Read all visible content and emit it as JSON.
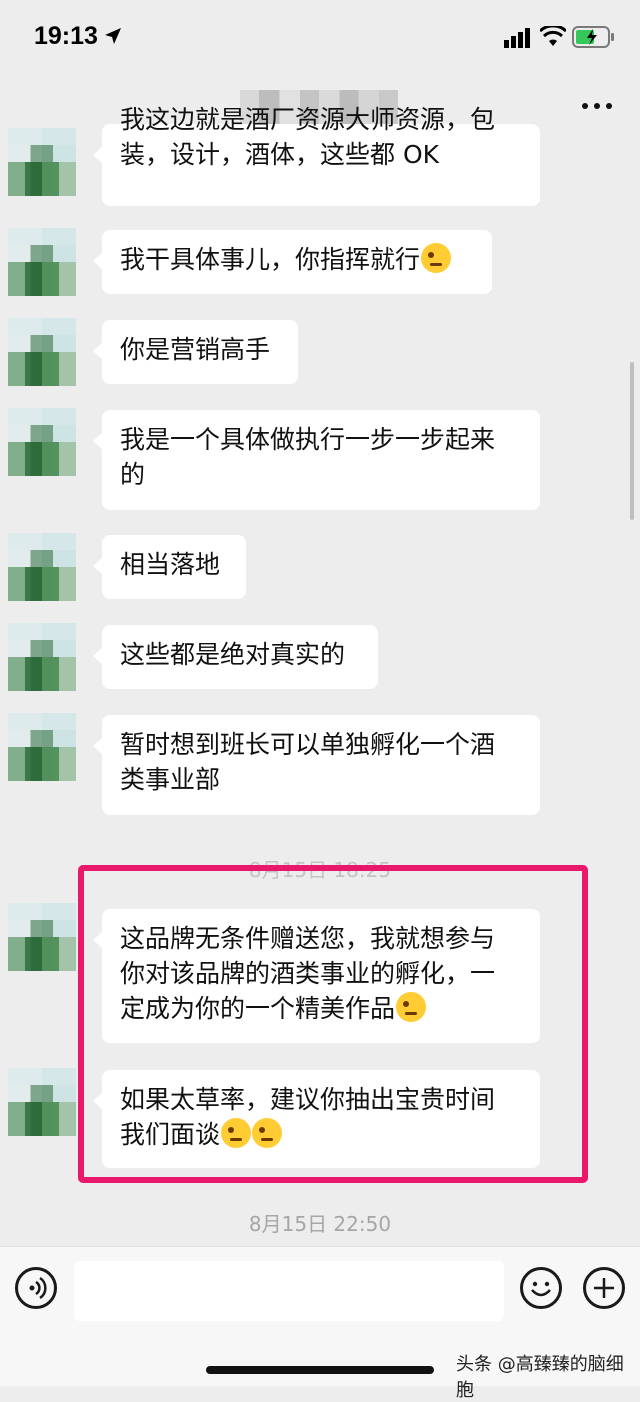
{
  "status_bar": {
    "time": "19:13",
    "icons": [
      "location-arrow-icon",
      "signal-bars-icon",
      "wifi-icon",
      "battery-charging-icon"
    ],
    "battery_color": "#34c759"
  },
  "header": {
    "more_icon": "ellipsis-icon"
  },
  "messages": [
    {
      "text": "我这边就是酒厂资源大师资源，包装，设计，酒体，这些都OK",
      "line1": "我这边就是酒厂资源大师资源，包",
      "line2": "装，设计，酒体，这些都 OK"
    },
    {
      "text": "我干具体事儿，你指挥就行",
      "emoji": true
    },
    {
      "text": "你是营销高手"
    },
    {
      "line1": "我是一个具体做执行一步一步起来",
      "line2": "的"
    },
    {
      "text": "相当落地"
    },
    {
      "text": "这些都是绝对真实的"
    },
    {
      "line1": "暂时想到班长可以单独孵化一个酒",
      "line2": "类事业部"
    },
    {
      "line1": "这品牌无条件赠送您，我就想参与",
      "line2": "你对该品牌的酒类事业的孵化，一",
      "line3": "定成为你的一个精美作品",
      "emoji": true
    },
    {
      "line1": "如果太草率，建议你抽出宝贵时间",
      "line2": "我们面谈",
      "emoji_count": 2
    }
  ],
  "timestamps": {
    "partial": "8月15日 18:25",
    "last": "8月15日 22:50"
  },
  "input_bar": {
    "voice_icon": "voice-icon",
    "emoji_icon": "smile-icon",
    "plus_icon": "plus-icon",
    "input_value": ""
  },
  "watermark": "头条 @高臻臻的脑细胞",
  "highlight_color": "#e8196a"
}
